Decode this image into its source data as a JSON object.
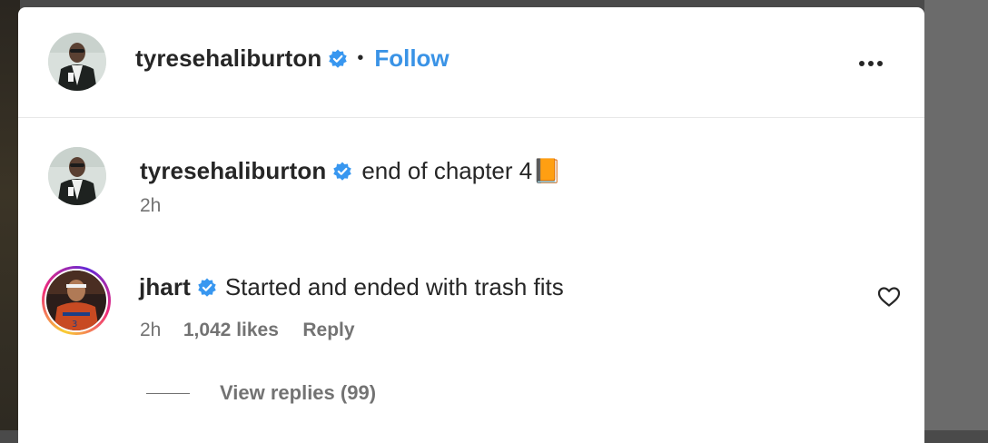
{
  "post": {
    "author": "tyresehaliburton",
    "follow_label": "Follow",
    "separator": "•",
    "more_label": "More options"
  },
  "caption": {
    "username": "tyresehaliburton",
    "text": "end of chapter 4📙",
    "time": "2h"
  },
  "comment": {
    "username": "jhart",
    "text": "Started and ended with trash fits",
    "time": "2h",
    "likes": "1,042 likes",
    "reply_label": "Reply",
    "view_replies": "View replies (99)"
  },
  "colors": {
    "verified": "#3897f0",
    "follow": "#3a93e6",
    "text": "#262626",
    "muted": "#737373"
  },
  "icons": [
    "verified-badge-icon",
    "more-options-icon",
    "heart-icon",
    "avatar"
  ]
}
